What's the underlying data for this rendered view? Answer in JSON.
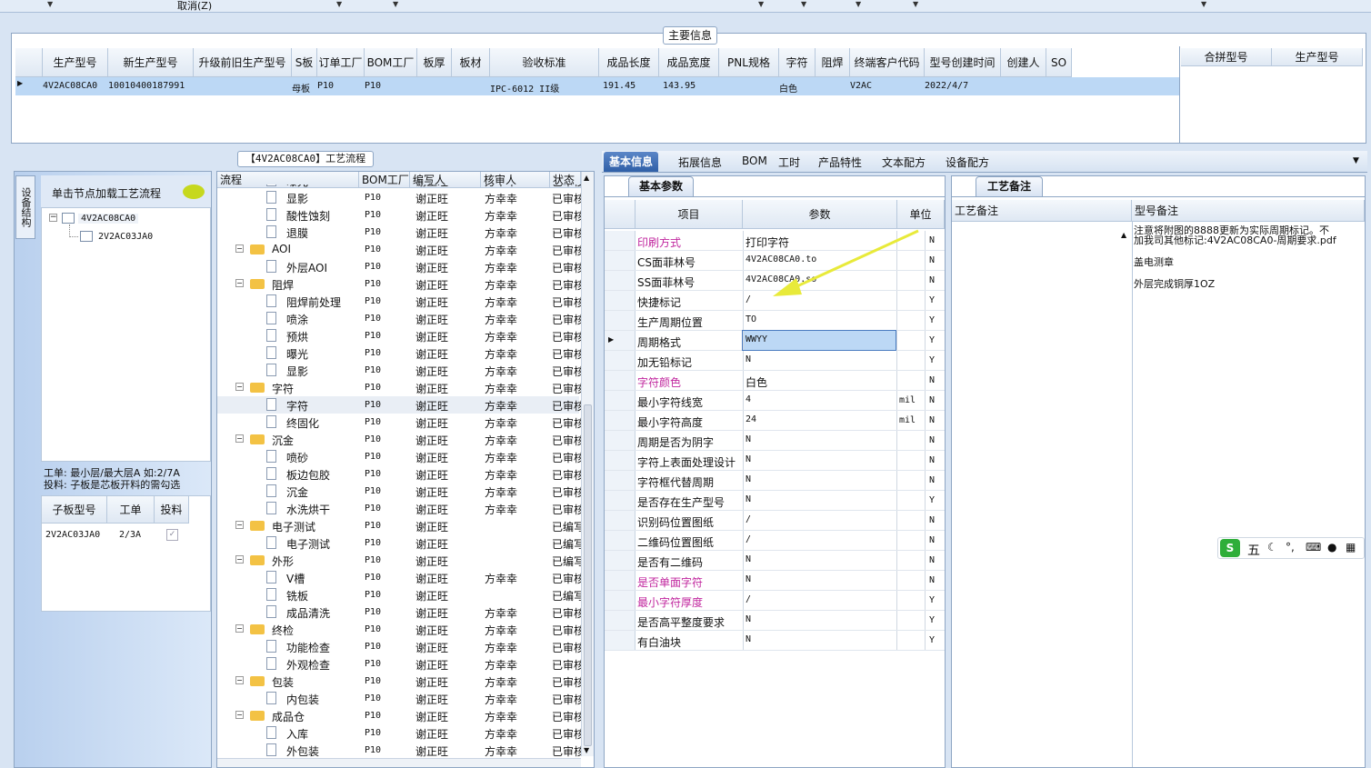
{
  "topbar": {
    "cancel_label": "取消(Z)"
  },
  "main": {
    "title": "主要信息",
    "columns": [
      "生产型号",
      "新生产型号",
      "升级前旧生产型号",
      "S板",
      "订单工厂",
      "BOM工厂",
      "板厚",
      "板材",
      "验收标准",
      "成品长度",
      "成品宽度",
      "PNL规格",
      "字符",
      "阻焊",
      "终端客户代码",
      "型号创建时间",
      "创建人",
      "SO"
    ],
    "row": [
      "4V2AC08CA0",
      "10010400187991",
      "",
      "母板",
      "P10",
      "P10",
      "",
      "",
      "IPC-6012 II级",
      "191.45",
      "143.95",
      "",
      "白色",
      "",
      "V2AC",
      "2022/4/7",
      "",
      ""
    ],
    "right_columns": [
      "合拼型号",
      "生产型号"
    ]
  },
  "leftpane": {
    "vtab": "设备结构",
    "hint": "单击节点加载工艺流程",
    "tree": [
      "4V2AC08CA0",
      "2V2AC03JA0"
    ],
    "note_line1": "工单: 最小层/最大层A 如:2/7A",
    "note_line2": "投料: 子板是芯板开料的需勾选",
    "sub_columns": [
      "子板型号",
      "工单",
      "投料"
    ],
    "sub_row": [
      "2V2AC03JA0",
      "2/3A",
      "✓"
    ]
  },
  "flow": {
    "title": "【4V2AC08CA0】工艺流程",
    "columns": [
      "流程",
      "BOM工厂",
      "编写人",
      "核审人",
      "状态"
    ],
    "rows": [
      {
        "name": "曝光",
        "level": 2,
        "bom": "P10",
        "writer": "谢正旺",
        "reviewer": "方幸幸",
        "status": "已审核"
      },
      {
        "name": "显影",
        "level": 2,
        "bom": "P10",
        "writer": "谢正旺",
        "reviewer": "方幸幸",
        "status": "已审核"
      },
      {
        "name": "酸性蚀刻",
        "level": 2,
        "bom": "P10",
        "writer": "谢正旺",
        "reviewer": "方幸幸",
        "status": "已审核"
      },
      {
        "name": "退膜",
        "level": 2,
        "bom": "P10",
        "writer": "谢正旺",
        "reviewer": "方幸幸",
        "status": "已审核"
      },
      {
        "name": "AOI",
        "level": 1,
        "bom": "P10",
        "writer": "谢正旺",
        "reviewer": "方幸幸",
        "status": "已审核"
      },
      {
        "name": "外层AOI",
        "level": 2,
        "bom": "P10",
        "writer": "谢正旺",
        "reviewer": "方幸幸",
        "status": "已审核"
      },
      {
        "name": "阻焊",
        "level": 1,
        "bom": "P10",
        "writer": "谢正旺",
        "reviewer": "方幸幸",
        "status": "已审核"
      },
      {
        "name": "阻焊前处理",
        "level": 2,
        "bom": "P10",
        "writer": "谢正旺",
        "reviewer": "方幸幸",
        "status": "已审核"
      },
      {
        "name": "喷涂",
        "level": 2,
        "bom": "P10",
        "writer": "谢正旺",
        "reviewer": "方幸幸",
        "status": "已审核"
      },
      {
        "name": "预烘",
        "level": 2,
        "bom": "P10",
        "writer": "谢正旺",
        "reviewer": "方幸幸",
        "status": "已审核"
      },
      {
        "name": "曝光",
        "level": 2,
        "bom": "P10",
        "writer": "谢正旺",
        "reviewer": "方幸幸",
        "status": "已审核"
      },
      {
        "name": "显影",
        "level": 2,
        "bom": "P10",
        "writer": "谢正旺",
        "reviewer": "方幸幸",
        "status": "已审核"
      },
      {
        "name": "字符",
        "level": 1,
        "bom": "P10",
        "writer": "谢正旺",
        "reviewer": "方幸幸",
        "status": "已审核"
      },
      {
        "name": "字符",
        "level": 2,
        "bom": "P10",
        "writer": "谢正旺",
        "reviewer": "方幸幸",
        "status": "已审核"
      },
      {
        "name": "终固化",
        "level": 2,
        "bom": "P10",
        "writer": "谢正旺",
        "reviewer": "方幸幸",
        "status": "已审核"
      },
      {
        "name": "沉金",
        "level": 1,
        "bom": "P10",
        "writer": "谢正旺",
        "reviewer": "方幸幸",
        "status": "已审核"
      },
      {
        "name": "喷砂",
        "level": 2,
        "bom": "P10",
        "writer": "谢正旺",
        "reviewer": "方幸幸",
        "status": "已审核"
      },
      {
        "name": "板边包胶",
        "level": 2,
        "bom": "P10",
        "writer": "谢正旺",
        "reviewer": "方幸幸",
        "status": "已审核"
      },
      {
        "name": "沉金",
        "level": 2,
        "bom": "P10",
        "writer": "谢正旺",
        "reviewer": "方幸幸",
        "status": "已审核"
      },
      {
        "name": "水洗烘干",
        "level": 2,
        "bom": "P10",
        "writer": "谢正旺",
        "reviewer": "方幸幸",
        "status": "已审核"
      },
      {
        "name": "电子测试",
        "level": 1,
        "bom": "P10",
        "writer": "谢正旺",
        "reviewer": "",
        "status": "已编写"
      },
      {
        "name": "电子测试",
        "level": 2,
        "bom": "P10",
        "writer": "谢正旺",
        "reviewer": "",
        "status": "已编写"
      },
      {
        "name": "外形",
        "level": 1,
        "bom": "P10",
        "writer": "谢正旺",
        "reviewer": "",
        "status": "已编写"
      },
      {
        "name": "V槽",
        "level": 2,
        "bom": "P10",
        "writer": "谢正旺",
        "reviewer": "方幸幸",
        "status": "已审核"
      },
      {
        "name": "铣板",
        "level": 2,
        "bom": "P10",
        "writer": "谢正旺",
        "reviewer": "",
        "status": "已编写"
      },
      {
        "name": "成品清洗",
        "level": 2,
        "bom": "P10",
        "writer": "谢正旺",
        "reviewer": "方幸幸",
        "status": "已审核"
      },
      {
        "name": "终检",
        "level": 1,
        "bom": "P10",
        "writer": "谢正旺",
        "reviewer": "方幸幸",
        "status": "已审核"
      },
      {
        "name": "功能检查",
        "level": 2,
        "bom": "P10",
        "writer": "谢正旺",
        "reviewer": "方幸幸",
        "status": "已审核"
      },
      {
        "name": "外观检查",
        "level": 2,
        "bom": "P10",
        "writer": "谢正旺",
        "reviewer": "方幸幸",
        "status": "已审核"
      },
      {
        "name": "包装",
        "level": 1,
        "bom": "P10",
        "writer": "谢正旺",
        "reviewer": "方幸幸",
        "status": "已审核"
      },
      {
        "name": "内包装",
        "level": 2,
        "bom": "P10",
        "writer": "谢正旺",
        "reviewer": "方幸幸",
        "status": "已审核"
      },
      {
        "name": "成品仓",
        "level": 1,
        "bom": "P10",
        "writer": "谢正旺",
        "reviewer": "方幸幸",
        "status": "已审核"
      },
      {
        "name": "入库",
        "level": 2,
        "bom": "P10",
        "writer": "谢正旺",
        "reviewer": "方幸幸",
        "status": "已审核"
      },
      {
        "name": "外包装",
        "level": 2,
        "bom": "P10",
        "writer": "谢正旺",
        "reviewer": "方幸幸",
        "status": "已审核"
      }
    ]
  },
  "tabs": [
    "基本信息",
    "拓展信息",
    "BOM",
    "工时",
    "产品特性",
    "文本配方",
    "设备配方"
  ],
  "params": {
    "subtab": "基本参数",
    "columns": [
      "项目",
      "参数",
      "单位"
    ],
    "rows": [
      {
        "item": "印刷方式",
        "value": "打印字符",
        "unit": "",
        "flag": "N",
        "pink": true
      },
      {
        "item": "CS面菲林号",
        "value": "4V2AC08CA0.to",
        "unit": "",
        "flag": "N",
        "pink": false
      },
      {
        "item": "SS面菲林号",
        "value": "4V2AC08CA0.so",
        "unit": "",
        "flag": "N",
        "pink": false
      },
      {
        "item": "快捷标记",
        "value": "/",
        "unit": "",
        "flag": "Y",
        "pink": false
      },
      {
        "item": "生产周期位置",
        "value": "TO",
        "unit": "",
        "flag": "Y",
        "pink": false
      },
      {
        "item": "周期格式",
        "value": "WWYY",
        "unit": "",
        "flag": "Y",
        "pink": false
      },
      {
        "item": "加无铅标记",
        "value": "N",
        "unit": "",
        "flag": "Y",
        "pink": false
      },
      {
        "item": "字符颜色",
        "value": "白色",
        "unit": "",
        "flag": "N",
        "pink": true
      },
      {
        "item": "最小字符线宽",
        "value": "4",
        "unit": "mil",
        "flag": "N",
        "pink": false
      },
      {
        "item": "最小字符高度",
        "value": "24",
        "unit": "mil",
        "flag": "N",
        "pink": false
      },
      {
        "item": "周期是否为阴字",
        "value": "N",
        "unit": "",
        "flag": "N",
        "pink": false
      },
      {
        "item": "字符上表面处理设计",
        "value": "N",
        "unit": "",
        "flag": "N",
        "pink": false
      },
      {
        "item": "字符框代替周期",
        "value": "N",
        "unit": "",
        "flag": "N",
        "pink": false
      },
      {
        "item": "是否存在生产型号",
        "value": "N",
        "unit": "",
        "flag": "Y",
        "pink": false
      },
      {
        "item": "识别码位置图纸",
        "value": "/",
        "unit": "",
        "flag": "N",
        "pink": false
      },
      {
        "item": "二维码位置图纸",
        "value": "/",
        "unit": "",
        "flag": "N",
        "pink": false
      },
      {
        "item": "是否有二维码",
        "value": "N",
        "unit": "",
        "flag": "N",
        "pink": false
      },
      {
        "item": "是否单面字符",
        "value": "N",
        "unit": "",
        "flag": "N",
        "pink": true
      },
      {
        "item": "最小字符厚度",
        "value": "/",
        "unit": "",
        "flag": "Y",
        "pink": true
      },
      {
        "item": "是否高平整度要求",
        "value": "N",
        "unit": "",
        "flag": "Y",
        "pink": false
      },
      {
        "item": "有白油块",
        "value": "N",
        "unit": "",
        "flag": "Y",
        "pink": false
      }
    ]
  },
  "remarks": {
    "subtab": "工艺备注",
    "col1": "工艺备注",
    "col2": "型号备注",
    "line1": "注意将附图的8888更新为实际周期标记。不",
    "line2": "加我司其他标记:4V2AC08CA0-周期要求.pdf",
    "line3": "盖电测章",
    "line4": "外层完成铜厚1OZ"
  },
  "ime": {
    "label": "五"
  },
  "colors": {
    "accent": "#2f5fa7",
    "pink": "#c0269e",
    "selection": "#bcd8f5",
    "arrow": "#e8ea3a"
  }
}
